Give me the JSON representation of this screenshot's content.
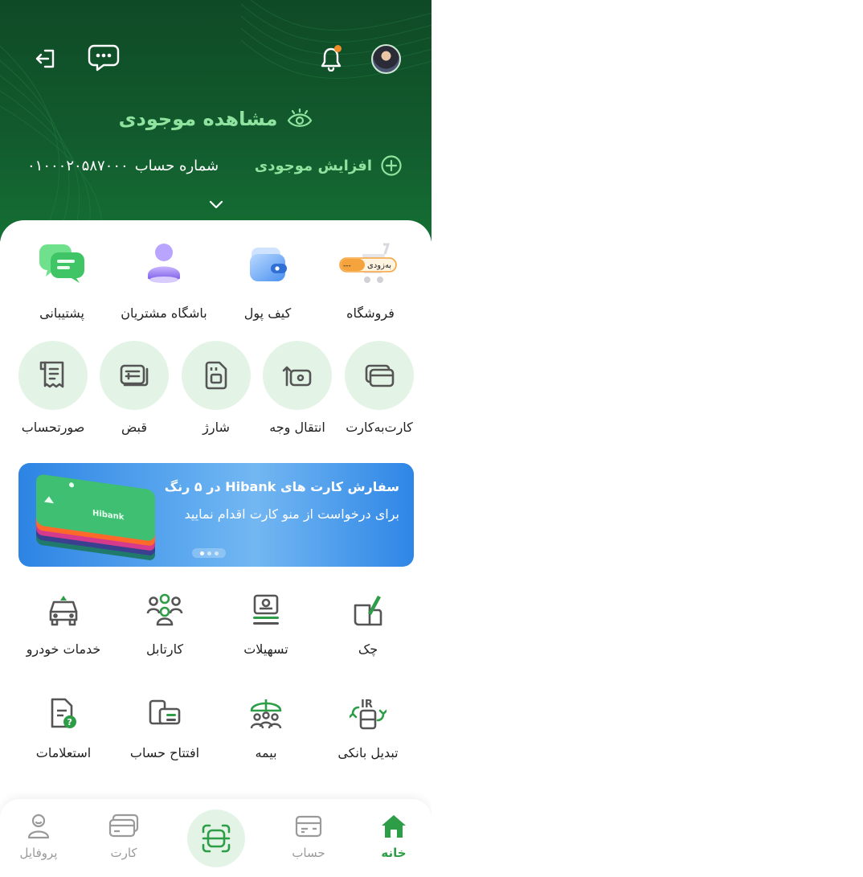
{
  "header": {
    "balance_label": "مشاهده موجودی",
    "topup_label": "افزایش موجودی",
    "account_label": "شماره حساب",
    "account_number": "۰۱۰۰۰۲۰۵۸۷۰۰۰",
    "notification_dot_color": "#f28c28",
    "accent_color": "#8fe39f"
  },
  "shortcuts": [
    {
      "label": "فروشگاه",
      "badge": "به‌زودی"
    },
    {
      "label": "کیف پول"
    },
    {
      "label": "باشگاه مشتریان"
    },
    {
      "label": "پشتیبانی"
    }
  ],
  "quick_actions": [
    {
      "label": "کارت‌به‌کارت",
      "icon": "card-to-card-icon"
    },
    {
      "label": "انتقال وجه",
      "icon": "transfer-icon"
    },
    {
      "label": "شارژ",
      "icon": "sim-card-icon"
    },
    {
      "label": "قبض",
      "icon": "bill-icon"
    },
    {
      "label": "صورتحساب",
      "icon": "receipt-icon"
    }
  ],
  "banner": {
    "title": "سفارش کارت های Hibank در ۵ رنگ",
    "subtitle": "برای درخواست از منو کارت اقدام نمایید",
    "card_brand": "Hibank",
    "slides_count": 3,
    "active_slide": 1
  },
  "services": [
    {
      "label": "چک",
      "icon": "cheque-icon"
    },
    {
      "label": "تسهیلات",
      "icon": "loan-icon"
    },
    {
      "label": "کارتابل",
      "icon": "group-icon"
    },
    {
      "label": "خدمات خودرو",
      "icon": "car-icon"
    },
    {
      "label": "تبدیل بانکی",
      "icon": "iban-convert-icon"
    },
    {
      "label": "بیمه",
      "icon": "insurance-icon"
    },
    {
      "label": "افتتاح حساب",
      "icon": "open-account-icon"
    },
    {
      "label": "استعلامات",
      "icon": "inquiry-icon"
    }
  ],
  "nav": {
    "items": [
      {
        "label": "خانه",
        "icon": "home-icon",
        "active": true
      },
      {
        "label": "حساب",
        "icon": "account-icon",
        "active": false
      },
      {
        "label": "کارت",
        "icon": "card-icon",
        "active": false
      },
      {
        "label": "پروفایل",
        "icon": "profile-icon",
        "active": false
      }
    ],
    "center_icon": "scan-icon",
    "active_color": "#2e9d47"
  }
}
